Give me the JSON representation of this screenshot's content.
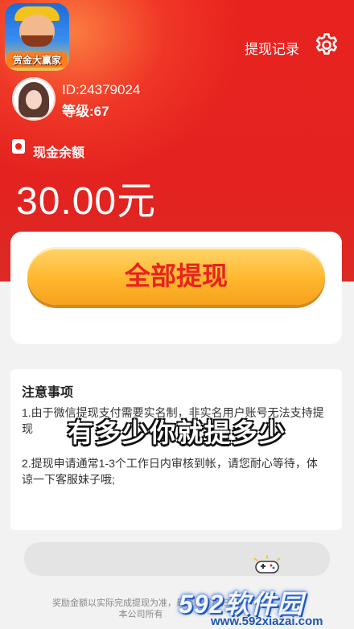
{
  "app_logo": {
    "text": "赏金大赢家"
  },
  "header": {
    "record_label": "提现记录",
    "settings_icon": "gear-icon"
  },
  "user": {
    "id_text": "ID:24379024",
    "level_text": "等级:67"
  },
  "balance": {
    "label": "现金余额",
    "amount": "30.00元",
    "icon": "wallet-icon"
  },
  "withdraw": {
    "button_label": "全部提现"
  },
  "notice": {
    "title": "注意事项",
    "item1": "1.由于微信提现支付需要实名制，非实名用户账号无法支持提现",
    "item2": "2.提现申请通常1-3个工作日内审核到帐，请您耐心等待，体谅一下客服妹子哦;"
  },
  "overlay": {
    "caption": "有多少你就提多少"
  },
  "bottom": {
    "text": "奖励金额以实际完成提现为准，最终解释权归本公司所有"
  },
  "watermark": {
    "main": "592软件园",
    "url": "www.592xiazai.com"
  },
  "colors": {
    "primary_red": "#e8231f",
    "button_gold": "#ffb72d",
    "text_dark": "#333333"
  }
}
